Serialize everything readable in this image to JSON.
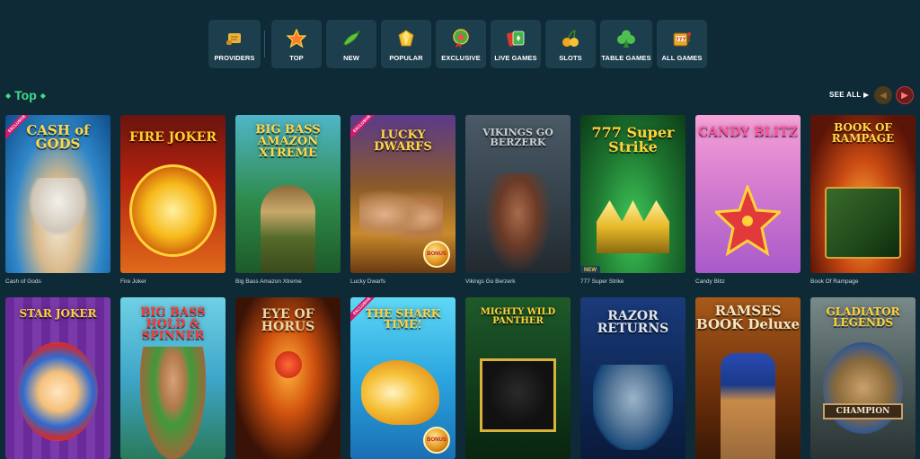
{
  "nav": [
    {
      "label": "PROVIDERS",
      "icon": "scroll-icon"
    },
    {
      "label": "TOP",
      "icon": "star-icon"
    },
    {
      "label": "NEW",
      "icon": "chili-icon"
    },
    {
      "label": "POPULAR",
      "icon": "gem-icon"
    },
    {
      "label": "EXCLUSIVE",
      "icon": "medal-icon"
    },
    {
      "label": "LIVE GAMES",
      "icon": "cards-icon"
    },
    {
      "label": "SLOTS",
      "icon": "cherries-icon"
    },
    {
      "label": "TABLE GAMES",
      "icon": "club-icon"
    },
    {
      "label": "ALL GAMES",
      "icon": "slot-machine-icon"
    }
  ],
  "section": {
    "title": "Top",
    "see_all": "SEE ALL",
    "prev_icon": "chevron-left-icon",
    "next_icon": "chevron-right-icon"
  },
  "games_row1": [
    {
      "name": "Cash of Gods",
      "logo": "CASH of GODS",
      "exclusive": true
    },
    {
      "name": "Fire Joker",
      "logo": "FIRE JOKER"
    },
    {
      "name": "Big Bass Amazon Xtreme",
      "logo": "BIG BASS AMAZON XTREME"
    },
    {
      "name": "Lucky Dwarfs",
      "logo": "LUCKY DWARFS",
      "exclusive": true,
      "bonus": "BONUS"
    },
    {
      "name": "Vikings Go Berzerk",
      "logo": "VIKINGS GO BERZERK"
    },
    {
      "name": "777 Super Strike",
      "logo": "777 Super Strike",
      "new": "NEW"
    },
    {
      "name": "Candy Blitz",
      "logo": "CANDY BLITZ"
    },
    {
      "name": "Book Of Rampage",
      "logo": "BOOK OF RAMPAGE"
    }
  ],
  "games_row2": [
    {
      "logo": "STAR JOKER"
    },
    {
      "logo": "BIG BASS HOLD & SPINNER"
    },
    {
      "logo": "EYE OF HORUS"
    },
    {
      "logo": "THE SHARK TIME!",
      "exclusive": true,
      "bonus": "BONUS"
    },
    {
      "logo": "MIGHTY WILD PANTHER"
    },
    {
      "logo": "RAZOR RETURNS"
    },
    {
      "logo": "RAMSES BOOK Deluxe"
    },
    {
      "logo": "GLADIATOR LEGENDS",
      "sub": "CHAMPION"
    }
  ],
  "exclusive_label": "EXCLUSIVE",
  "colors": {
    "background": "#0f2a37",
    "nav_tile": "#1d3e4c",
    "accent_green": "#3fe08a",
    "next_red": "#6b1b1b"
  }
}
